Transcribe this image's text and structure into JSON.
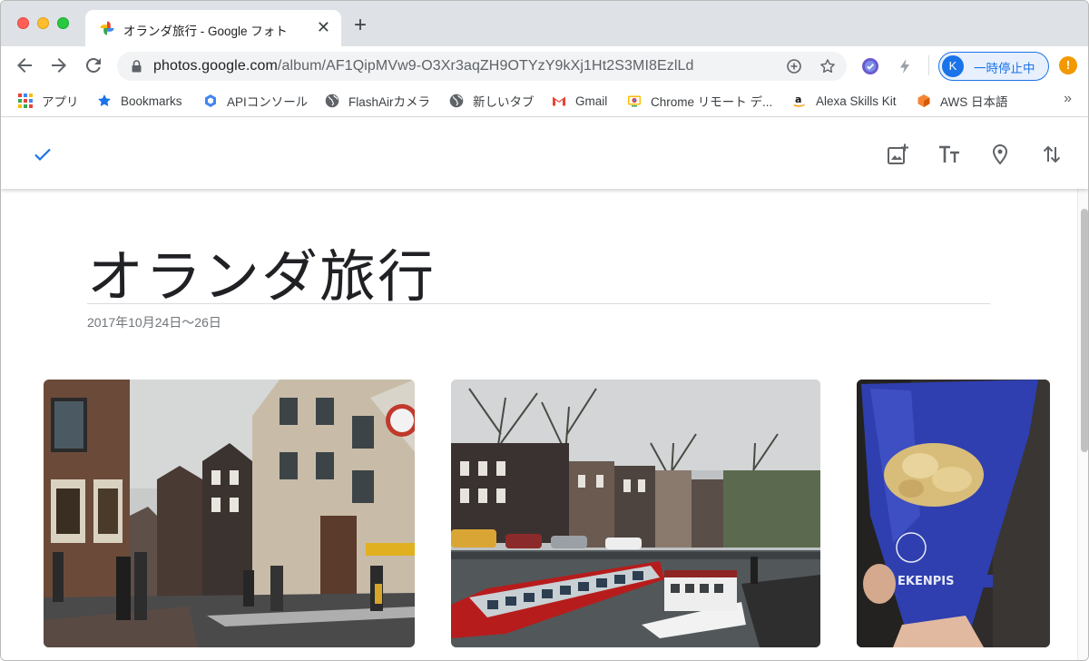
{
  "window": {
    "tab_title": "オランダ旅行 - Google フォト",
    "tab_close": "✕",
    "new_tab": "+"
  },
  "toolbar": {
    "url_host": "photos.google.com",
    "url_path": "/album/AF1QipMVw9-O3Xr3aqZH9OTYzY9kXj1Ht2S3MI8EzlLd",
    "profile_initial": "K",
    "profile_status": "一時停止中",
    "alert": "!"
  },
  "bookmarks": [
    {
      "label": "アプリ",
      "icon": "apps-grid-icon"
    },
    {
      "label": "Bookmarks",
      "icon": "star-icon"
    },
    {
      "label": "APIコンソール",
      "icon": "gcp-icon"
    },
    {
      "label": "FlashAirカメラ",
      "icon": "globe-icon"
    },
    {
      "label": "新しいタブ",
      "icon": "globe-icon"
    },
    {
      "label": "Gmail",
      "icon": "gmail-icon"
    },
    {
      "label": "Chrome リモート デ...",
      "icon": "chrome-remote-icon"
    },
    {
      "label": "Alexa Skills Kit",
      "icon": "amazon-icon"
    },
    {
      "label": "AWS 日本語",
      "icon": "aws-icon"
    }
  ],
  "bookmarks_more": "»",
  "appbar": {
    "done_icon": "check-icon",
    "actions": [
      "add-photo-icon",
      "text-format-icon",
      "location-pin-icon",
      "sort-icon"
    ]
  },
  "album": {
    "title": "オランダ旅行",
    "date": "2017年10月24日〜26日"
  },
  "photos": [
    {
      "name": "amsterdam-street-photo"
    },
    {
      "name": "amsterdam-canal-photo"
    },
    {
      "name": "fries-cone-photo"
    }
  ],
  "colors": {
    "accent": "#1a73e8",
    "tab_strip": "#dee1e6",
    "title_text": "#202124",
    "date_text": "#70757a"
  }
}
